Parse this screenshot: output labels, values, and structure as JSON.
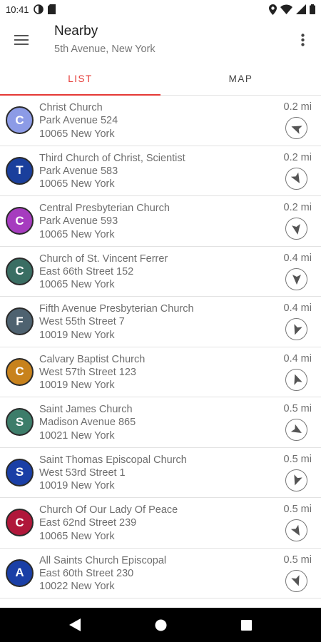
{
  "status_bar": {
    "time": "10:41"
  },
  "header": {
    "title": "Nearby",
    "subtitle": "5th Avenue, New York"
  },
  "tabs": [
    {
      "label": "LIST",
      "active": true
    },
    {
      "label": "MAP",
      "active": false
    }
  ],
  "accent_color": "#e53935",
  "places": [
    {
      "initial": "C",
      "color": "#8c9be6",
      "name": "Christ Church",
      "street": "Park Avenue 524",
      "city": "10065 New York",
      "distance": "0.2 mi",
      "bearing": 200
    },
    {
      "initial": "T",
      "color": "#1a3f9c",
      "name": "Third Church of Christ, Scientist",
      "street": "Park Avenue 583",
      "city": "10065 New York",
      "distance": "0.2 mi",
      "bearing": 60
    },
    {
      "initial": "C",
      "color": "#a63cbf",
      "name": "Central Presbyterian Church",
      "street": "Park Avenue 593",
      "city": "10065 New York",
      "distance": "0.2 mi",
      "bearing": 80
    },
    {
      "initial": "C",
      "color": "#3a6e63",
      "name": "Church of St. Vincent Ferrer",
      "street": "East 66th Street 152",
      "city": "10065 New York",
      "distance": "0.4 mi",
      "bearing": 90
    },
    {
      "initial": "F",
      "color": "#4e6270",
      "name": "Fifth Avenue Presbyterian Church",
      "street": "West 55th Street 7",
      "city": "10019 New York",
      "distance": "0.4 mi",
      "bearing": 110
    },
    {
      "initial": "C",
      "color": "#c8821c",
      "name": "Calvary Baptist Church",
      "street": "West 57th Street 123",
      "city": "10019 New York",
      "distance": "0.4 mi",
      "bearing": 250
    },
    {
      "initial": "S",
      "color": "#3d7d6a",
      "name": "Saint James Church",
      "street": "Madison Avenue 865",
      "city": "10021 New York",
      "distance": "0.5 mi",
      "bearing": 30
    },
    {
      "initial": "S",
      "color": "#1a3fa6",
      "name": "Saint Thomas Episcopal Church",
      "street": "West 53rd Street 1",
      "city": "10019 New York",
      "distance": "0.5 mi",
      "bearing": 110
    },
    {
      "initial": "C",
      "color": "#b0173a",
      "name": "Church Of Our Lady Of Peace",
      "street": "East 62nd Street 239",
      "city": "10065 New York",
      "distance": "0.5 mi",
      "bearing": 60
    },
    {
      "initial": "A",
      "color": "#1a3fa6",
      "name": "All Saints Church Episcopal",
      "street": "East 60th Street 230",
      "city": "10022 New York",
      "distance": "0.5 mi",
      "bearing": 70
    }
  ]
}
